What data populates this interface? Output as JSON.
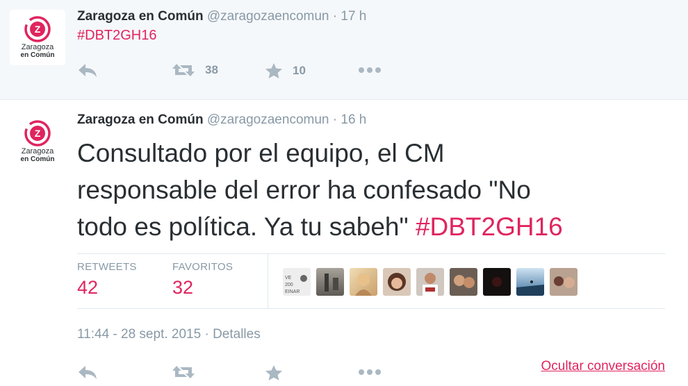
{
  "tweets": [
    {
      "avatar": {
        "line1": "Zaragoza",
        "line2": "en Común"
      },
      "author_name": "Zaragoza en Común",
      "handle": "@zaragozaencomun",
      "separator": "·",
      "time": "17 h",
      "text": "#DBT2GH16",
      "actions": {
        "reply_icon": "reply-icon",
        "retweet_icon": "retweet-icon",
        "retweet_count": "38",
        "favorite_icon": "star-icon",
        "favorite_count": "10",
        "more_icon": "more-dots-icon"
      }
    },
    {
      "avatar": {
        "line1": "Zaragoza",
        "line2": "en Común"
      },
      "author_name": "Zaragoza en Común",
      "handle": "@zaragozaencomun",
      "separator": "·",
      "time": "16 h",
      "text_line1": "Consultado por el equipo, el CM",
      "text_line2": "responsable del error ha confesado \"No",
      "text_line3": "todo es política. Ya tu sabeh\"",
      "hashtag": "#DBT2GH16",
      "stats": {
        "retweets_label": "RETWEETS",
        "retweets_value": "42",
        "favorites_label": "FAVORITOS",
        "favorites_value": "32"
      },
      "favoriter_avatars": [
        "avatar-1",
        "avatar-2",
        "avatar-3",
        "avatar-4",
        "avatar-5",
        "avatar-6",
        "avatar-7",
        "avatar-8",
        "avatar-9"
      ],
      "timestamp": "11:44 - 28 sept. 2015",
      "details_link": "Detalles",
      "actions": {
        "reply_icon": "reply-icon",
        "retweet_icon": "retweet-icon",
        "favorite_icon": "star-icon",
        "more_icon": "more-dots-icon"
      },
      "hide_conversation": "Ocultar conversación"
    }
  ],
  "colors": {
    "accent": "#e0245e",
    "muted": "#8899a6",
    "icon": "#aab8c2",
    "text": "#292f33",
    "tweet1_bg": "#f5f8fa",
    "border": "#e1e8ed"
  }
}
